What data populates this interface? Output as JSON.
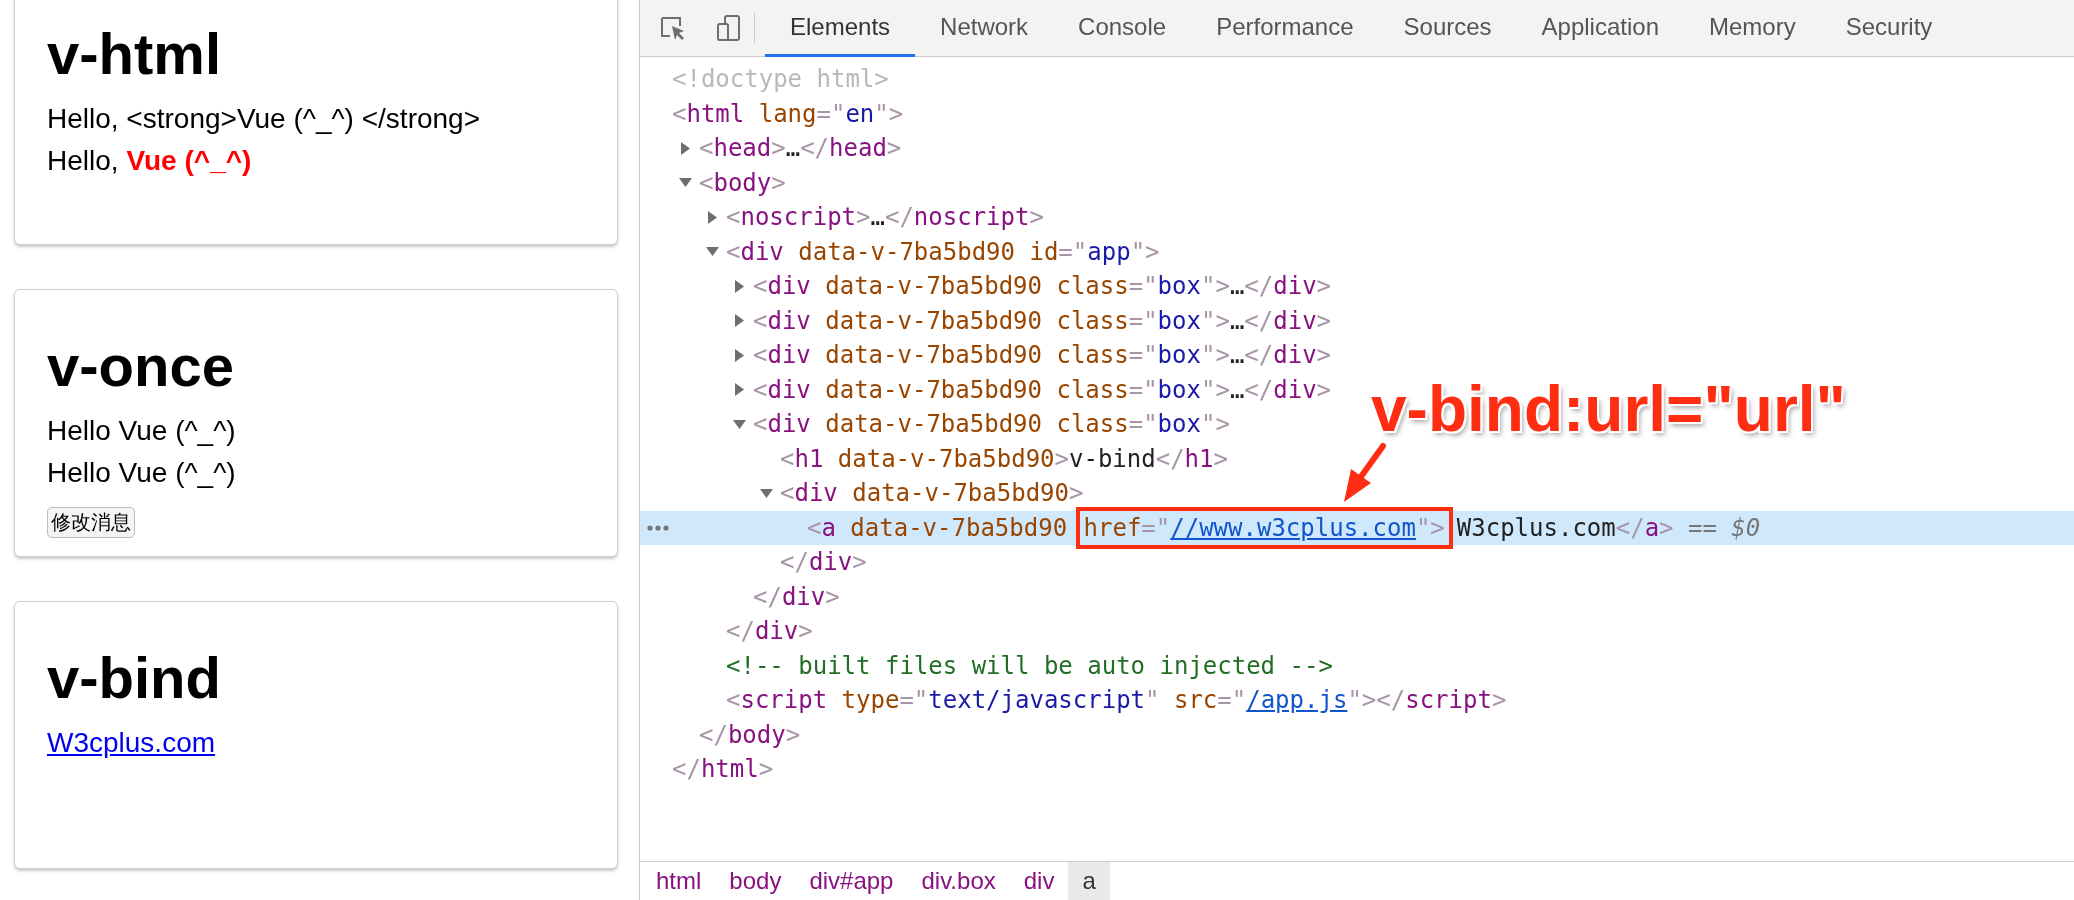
{
  "demo_cards": [
    {
      "title": "v-html",
      "items": [
        {
          "kind": "text",
          "text": "Hello, <strong>Vue (^_^) </strong>"
        },
        {
          "kind": "text",
          "text": "Hello, **Vue (^_^)**"
        }
      ]
    },
    {
      "title": "v-once",
      "items": [
        {
          "kind": "text",
          "text": "Hello Vue (^_^)"
        },
        {
          "kind": "text",
          "text": "Hello Vue (^_^)"
        },
        {
          "kind": "button",
          "text": "修改消息"
        }
      ]
    },
    {
      "title": "v-bind",
      "items": [
        {
          "kind": "link",
          "text": "W3cplus.com"
        }
      ]
    }
  ],
  "devtools": {
    "tabs": [
      {
        "label": "Elements",
        "selected": true
      },
      {
        "label": "Network",
        "selected": false
      },
      {
        "label": "Console",
        "selected": false
      },
      {
        "label": "Performance",
        "selected": false
      },
      {
        "label": "Sources",
        "selected": false
      },
      {
        "label": "Application",
        "selected": false
      },
      {
        "label": "Memory",
        "selected": false
      },
      {
        "label": "Security",
        "selected": false
      }
    ],
    "dom_tree": [
      {
        "selected": false,
        "tokens": [
          {
            "text": "<!doctype html>",
            "kind": "doctype"
          }
        ]
      },
      {
        "selected": false,
        "tokens": [
          {
            "text": "<",
            "kind": "bracket"
          },
          {
            "text": "html",
            "kind": "tag"
          },
          {
            "text": " lang",
            "kind": "attr"
          },
          {
            "text": "=\"",
            "kind": "bracket"
          },
          {
            "text": "en",
            "kind": "value"
          },
          {
            "text": "\">",
            "kind": "bracket"
          }
        ],
        "closing": [
          {
            "text": "</",
            "kind": "bracket"
          },
          {
            "text": "html",
            "kind": "tag"
          },
          {
            "text": ">",
            "kind": "bracket"
          }
        ],
        "children": [
          {
            "selected": false,
            "expanded": false,
            "tokens": [
              {
                "text": "<",
                "kind": "bracket"
              },
              {
                "text": "head",
                "kind": "tag"
              },
              {
                "text": ">",
                "kind": "bracket"
              },
              {
                "text": "…",
                "kind": "text"
              },
              {
                "text": "</",
                "kind": "bracket"
              },
              {
                "text": "head",
                "kind": "tag"
              },
              {
                "text": ">",
                "kind": "bracket"
              }
            ]
          },
          {
            "selected": false,
            "expanded": true,
            "tokens": [
              {
                "text": "<",
                "kind": "bracket"
              },
              {
                "text": "body",
                "kind": "tag"
              },
              {
                "text": ">",
                "kind": "bracket"
              }
            ],
            "closing": [
              {
                "text": "</",
                "kind": "bracket"
              },
              {
                "text": "body",
                "kind": "tag"
              },
              {
                "text": ">",
                "kind": "bracket"
              }
            ],
            "children": [
              {
                "selected": false,
                "expanded": false,
                "tokens": [
                  {
                    "text": "<",
                    "kind": "bracket"
                  },
                  {
                    "text": "noscript",
                    "kind": "tag"
                  },
                  {
                    "text": ">",
                    "kind": "bracket"
                  },
                  {
                    "text": "…",
                    "kind": "text"
                  },
                  {
                    "text": "</",
                    "kind": "bracket"
                  },
                  {
                    "text": "noscript",
                    "kind": "tag"
                  },
                  {
                    "text": ">",
                    "kind": "bracket"
                  }
                ]
              },
              {
                "selected": false,
                "expanded": true,
                "tokens": [
                  {
                    "text": "<",
                    "kind": "bracket"
                  },
                  {
                    "text": "div",
                    "kind": "tag"
                  },
                  {
                    "text": " data-v-7ba5bd90",
                    "kind": "attr"
                  },
                  {
                    "text": " id",
                    "kind": "attr"
                  },
                  {
                    "text": "=\"",
                    "kind": "bracket"
                  },
                  {
                    "text": "app",
                    "kind": "value"
                  },
                  {
                    "text": "\">",
                    "kind": "bracket"
                  }
                ],
                "closing": [
                  {
                    "text": "</",
                    "kind": "bracket"
                  },
                  {
                    "text": "div",
                    "kind": "tag"
                  },
                  {
                    "text": ">",
                    "kind": "bracket"
                  }
                ],
                "children": [
                  {
                    "selected": false,
                    "expanded": false,
                    "tokens": [
                      {
                        "text": "<",
                        "kind": "bracket"
                      },
                      {
                        "text": "div",
                        "kind": "tag"
                      },
                      {
                        "text": " data-v-7ba5bd90",
                        "kind": "attr"
                      },
                      {
                        "text": " class",
                        "kind": "attr"
                      },
                      {
                        "text": "=\"",
                        "kind": "bracket"
                      },
                      {
                        "text": "box",
                        "kind": "value"
                      },
                      {
                        "text": "\">",
                        "kind": "bracket"
                      },
                      {
                        "text": "…",
                        "kind": "text"
                      },
                      {
                        "text": "</",
                        "kind": "bracket"
                      },
                      {
                        "text": "div",
                        "kind": "tag"
                      },
                      {
                        "text": ">",
                        "kind": "bracket"
                      }
                    ]
                  },
                  {
                    "selected": false,
                    "expanded": false,
                    "tokens": [
                      {
                        "text": "<",
                        "kind": "bracket"
                      },
                      {
                        "text": "div",
                        "kind": "tag"
                      },
                      {
                        "text": " data-v-7ba5bd90",
                        "kind": "attr"
                      },
                      {
                        "text": " class",
                        "kind": "attr"
                      },
                      {
                        "text": "=\"",
                        "kind": "bracket"
                      },
                      {
                        "text": "box",
                        "kind": "value"
                      },
                      {
                        "text": "\">",
                        "kind": "bracket"
                      },
                      {
                        "text": "…",
                        "kind": "text"
                      },
                      {
                        "text": "</",
                        "kind": "bracket"
                      },
                      {
                        "text": "div",
                        "kind": "tag"
                      },
                      {
                        "text": ">",
                        "kind": "bracket"
                      }
                    ]
                  },
                  {
                    "selected": false,
                    "expanded": false,
                    "tokens": [
                      {
                        "text": "<",
                        "kind": "bracket"
                      },
                      {
                        "text": "div",
                        "kind": "tag"
                      },
                      {
                        "text": " data-v-7ba5bd90",
                        "kind": "attr"
                      },
                      {
                        "text": " class",
                        "kind": "attr"
                      },
                      {
                        "text": "=\"",
                        "kind": "bracket"
                      },
                      {
                        "text": "box",
                        "kind": "value"
                      },
                      {
                        "text": "\">",
                        "kind": "bracket"
                      },
                      {
                        "text": "…",
                        "kind": "text"
                      },
                      {
                        "text": "</",
                        "kind": "bracket"
                      },
                      {
                        "text": "div",
                        "kind": "tag"
                      },
                      {
                        "text": ">",
                        "kind": "bracket"
                      }
                    ]
                  },
                  {
                    "selected": false,
                    "expanded": false,
                    "tokens": [
                      {
                        "text": "<",
                        "kind": "bracket"
                      },
                      {
                        "text": "div",
                        "kind": "tag"
                      },
                      {
                        "text": " data-v-7ba5bd90",
                        "kind": "attr"
                      },
                      {
                        "text": " class",
                        "kind": "attr"
                      },
                      {
                        "text": "=\"",
                        "kind": "bracket"
                      },
                      {
                        "text": "box",
                        "kind": "value"
                      },
                      {
                        "text": "\">",
                        "kind": "bracket"
                      },
                      {
                        "text": "…",
                        "kind": "text"
                      },
                      {
                        "text": "</",
                        "kind": "bracket"
                      },
                      {
                        "text": "div",
                        "kind": "tag"
                      },
                      {
                        "text": ">",
                        "kind": "bracket"
                      }
                    ]
                  },
                  {
                    "selected": false,
                    "expanded": true,
                    "tokens": [
                      {
                        "text": "<",
                        "kind": "bracket"
                      },
                      {
                        "text": "div",
                        "kind": "tag"
                      },
                      {
                        "text": " data-v-7ba5bd90",
                        "kind": "attr"
                      },
                      {
                        "text": " class",
                        "kind": "attr"
                      },
                      {
                        "text": "=\"",
                        "kind": "bracket"
                      },
                      {
                        "text": "box",
                        "kind": "value"
                      },
                      {
                        "text": "\">",
                        "kind": "bracket"
                      }
                    ],
                    "closing": [
                      {
                        "text": "</",
                        "kind": "bracket"
                      },
                      {
                        "text": "div",
                        "kind": "tag"
                      },
                      {
                        "text": ">",
                        "kind": "bracket"
                      }
                    ],
                    "children": [
                      {
                        "selected": false,
                        "tokens": [
                          {
                            "text": "<",
                            "kind": "bracket"
                          },
                          {
                            "text": "h1",
                            "kind": "tag"
                          },
                          {
                            "text": " data-v-7ba5bd90",
                            "kind": "attr"
                          },
                          {
                            "text": ">",
                            "kind": "bracket"
                          },
                          {
                            "text": "v-bind",
                            "kind": "text"
                          },
                          {
                            "text": "</",
                            "kind": "bracket"
                          },
                          {
                            "text": "h1",
                            "kind": "tag"
                          },
                          {
                            "text": ">",
                            "kind": "bracket"
                          }
                        ]
                      },
                      {
                        "selected": false,
                        "expanded": true,
                        "tokens": [
                          {
                            "text": "<",
                            "kind": "bracket"
                          },
                          {
                            "text": "div",
                            "kind": "tag"
                          },
                          {
                            "text": " data-v-7ba5bd90",
                            "kind": "attr"
                          },
                          {
                            "text": ">",
                            "kind": "bracket"
                          }
                        ],
                        "closing": [
                          {
                            "text": "</",
                            "kind": "bracket"
                          },
                          {
                            "text": "div",
                            "kind": "tag"
                          },
                          {
                            "text": ">",
                            "kind": "bracket"
                          }
                        ],
                        "children": [
                          {
                            "selected": true,
                            "tokens": [
                              {
                                "text": "<",
                                "kind": "bracket"
                              },
                              {
                                "text": "a",
                                "kind": "tag"
                              },
                              {
                                "text": " data-v-7ba5bd90 ",
                                "kind": "attr"
                              }
                            ],
                            "boxed_tokens": [
                              {
                                "text": "href",
                                "kind": "attr"
                              },
                              {
                                "text": "=\"",
                                "kind": "bracket"
                              },
                              {
                                "text": "//www.w3cplus.com",
                                "kind": "link"
                              },
                              {
                                "text": "\">",
                                "kind": "bracket"
                              }
                            ],
                            "after_tokens": [
                              {
                                "text": "W3cplus.com",
                                "kind": "text"
                              },
                              {
                                "text": "</",
                                "kind": "bracket"
                              },
                              {
                                "text": "a",
                                "kind": "tag"
                              },
                              {
                                "text": ">",
                                "kind": "bracket"
                              },
                              {
                                "text": " == ",
                                "kind": "hint"
                              },
                              {
                                "text": "$0",
                                "kind": "var"
                              }
                            ]
                          }
                        ]
                      }
                    ]
                  }
                ]
              },
              {
                "selected": false,
                "tokens": [
                  {
                    "text": "<!-- built files will be auto injected -->",
                    "kind": "comment"
                  }
                ]
              },
              {
                "selected": false,
                "tokens": [
                  {
                    "text": "<",
                    "kind": "bracket"
                  },
                  {
                    "text": "script",
                    "kind": "tag"
                  },
                  {
                    "text": " type",
                    "kind": "attr"
                  },
                  {
                    "text": "=\"",
                    "kind": "bracket"
                  },
                  {
                    "text": "text/javascript",
                    "kind": "value"
                  },
                  {
                    "text": "\"",
                    "kind": "bracket"
                  },
                  {
                    "text": " src",
                    "kind": "attr"
                  },
                  {
                    "text": "=\"",
                    "kind": "bracket"
                  },
                  {
                    "text": "/app.js",
                    "kind": "link"
                  },
                  {
                    "text": "\">",
                    "kind": "bracket"
                  },
                  {
                    "text": "</",
                    "kind": "bracket"
                  },
                  {
                    "text": "script",
                    "kind": "tag"
                  },
                  {
                    "text": ">",
                    "kind": "bracket"
                  }
                ]
              }
            ]
          }
        ]
      }
    ],
    "annotation": {
      "text": "v-bind:url=\"url\""
    },
    "breadcrumbs": [
      {
        "label": "html",
        "selected": false
      },
      {
        "label": "body",
        "selected": false
      },
      {
        "label": "div#app",
        "selected": false
      },
      {
        "label": "div.box",
        "selected": false
      },
      {
        "label": "div",
        "selected": false
      },
      {
        "label": "a",
        "selected": true
      }
    ]
  }
}
